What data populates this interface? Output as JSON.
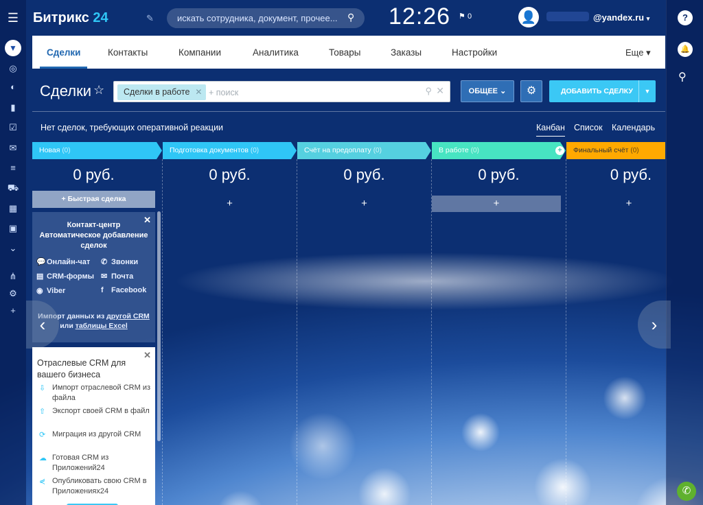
{
  "header": {
    "logo_main": "Битрикс",
    "logo_num": "24",
    "search_placeholder": "искать сотрудника, документ, прочее...",
    "clock": "12:26",
    "flag_count": "0",
    "user_email": "@yandex.ru",
    "user_dropdown": "▾"
  },
  "nav": {
    "tabs": [
      {
        "label": "Сделки"
      },
      {
        "label": "Контакты"
      },
      {
        "label": "Компании"
      },
      {
        "label": "Аналитика"
      },
      {
        "label": "Товары"
      },
      {
        "label": "Заказы"
      },
      {
        "label": "Настройки"
      }
    ],
    "more_label": "Еще ▾"
  },
  "page": {
    "title": "Сделки",
    "filter_chip": "Сделки в работе",
    "filter_placeholder": "+ поиск",
    "general_button": "ОБЩЕЕ",
    "add_button": "ДОБАВИТЬ СДЕЛКУ",
    "notice": "Нет сделок, требующих оперативной реакции",
    "views": [
      {
        "label": "Канбан"
      },
      {
        "label": "Список"
      },
      {
        "label": "Календарь"
      }
    ]
  },
  "kanban": {
    "quick_deal": "+ Быстрая сделка",
    "columns": [
      {
        "name": "Новая",
        "count": "(0)",
        "sum": "0 руб.",
        "color": "#2fc6f6"
      },
      {
        "name": "Подготовка документов",
        "count": "(0)",
        "sum": "0 руб.",
        "color": "#2fc6f6"
      },
      {
        "name": "Счёт на предоплату",
        "count": "(0)",
        "sum": "0 руб.",
        "color": "#55d0e0"
      },
      {
        "name": "В работе",
        "count": "(0)",
        "sum": "0 руб.",
        "color": "#47e4c2"
      },
      {
        "name": "Финальный счёт",
        "count": "(0)",
        "sum": "0 руб.",
        "color": "#ffa900"
      }
    ],
    "add_symbol": "+"
  },
  "contact_center": {
    "title": "Контакт-центр Автоматическое добавление сделок",
    "items": {
      "online_chat": "Онлайн-чат",
      "calls": "Звонки",
      "crm_forms": "CRM-формы",
      "mail": "Почта",
      "viber": "Viber",
      "facebook": "Facebook"
    },
    "import_prefix": "Импорт данных из ",
    "import_link1": "другой CRM",
    "import_mid": " или ",
    "import_link2": "таблицы Excel"
  },
  "industry": {
    "title": "Отраслевые CRM для вашего бизнеса",
    "items": [
      {
        "label": "Импорт отраслевой CRM из файла"
      },
      {
        "label": "Экспорт своей CRM в файл"
      },
      {
        "label": "Миграция из другой CRM"
      },
      {
        "label": "Готовая CRM из Приложений24"
      },
      {
        "label": "Опубликовать свою CRM в Приложениях24"
      }
    ]
  },
  "right_bar": {
    "help": "?",
    "bell": "🔔",
    "search": "⚲"
  },
  "colors": {
    "accent": "#2067b0",
    "button_blue": "#2f6eb5",
    "add_button": "#3bc8f5",
    "phone": "#5fb12e"
  }
}
